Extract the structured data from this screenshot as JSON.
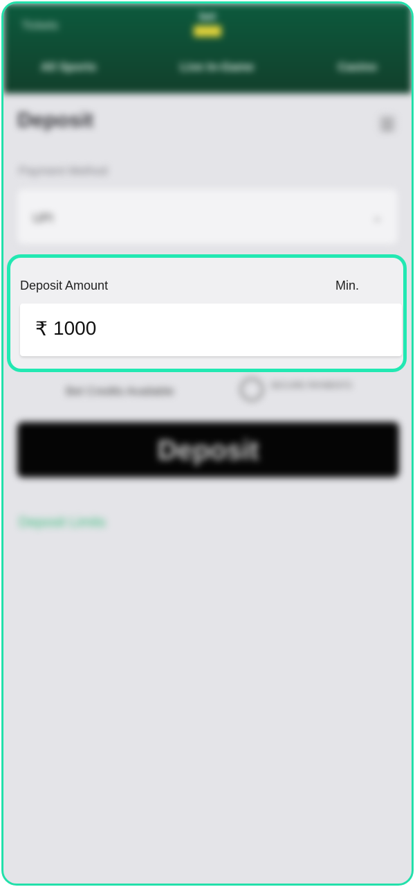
{
  "header": {
    "top_link": "Tickets",
    "logo_text": "bet",
    "nav": [
      "All Sports",
      "Live In-Game",
      "Casino"
    ]
  },
  "page": {
    "title": "Deposit",
    "menu_icon": "hamburger-menu-icon"
  },
  "payment_method": {
    "label": "Payment Method",
    "value": "UPI",
    "chevron_icon": "chevron-down-icon"
  },
  "deposit_amount": {
    "label": "Deposit Amount",
    "min_label": "Min.",
    "currency_symbol": "₹",
    "value": "1000"
  },
  "promo": {
    "text": "Bet Credits Available",
    "badge_text": "SECURE PAYMENTS"
  },
  "actions": {
    "deposit_button": "Deposit",
    "deposit_limits_link": "Deposit Limits"
  },
  "colors": {
    "highlight_border": "#22e8b2",
    "header_bg": "#0c5a3d",
    "link_green": "#3cbd7e",
    "button_bg": "#050505"
  }
}
